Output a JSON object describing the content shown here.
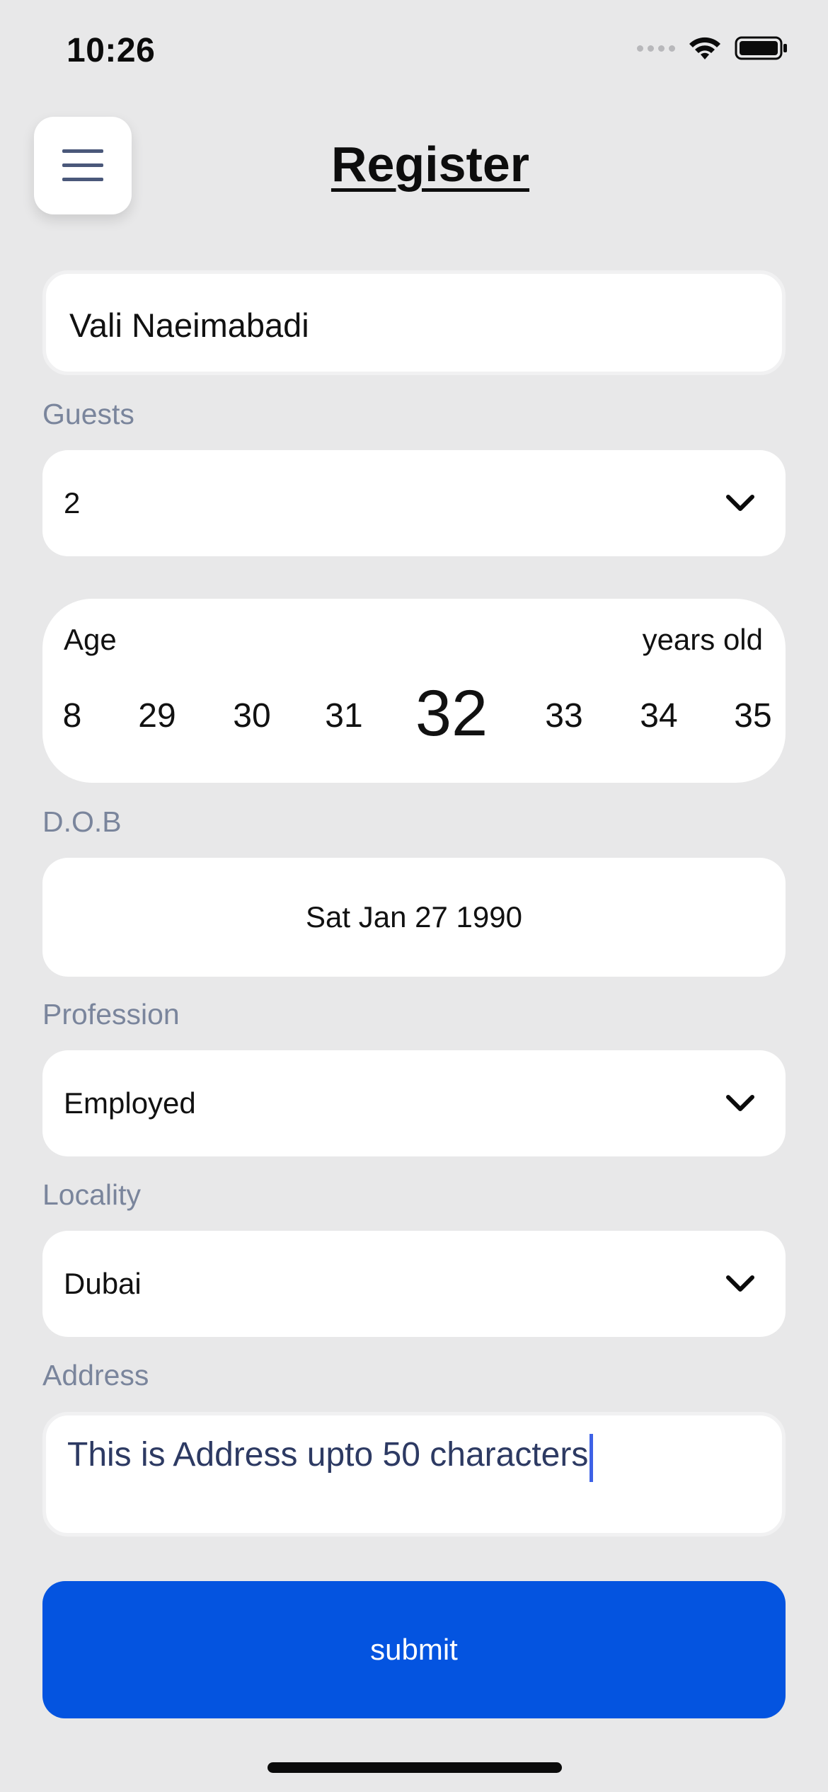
{
  "status_bar": {
    "time": "10:26"
  },
  "header": {
    "title": "Register",
    "menu_icon": "hamburger-menu-icon"
  },
  "form": {
    "name": {
      "value": "Vali Naeimabadi"
    },
    "guests": {
      "label": "Guests",
      "value": "2"
    },
    "age": {
      "label": "Age",
      "unit": "years old",
      "options": [
        "8",
        "29",
        "30",
        "31",
        "32",
        "33",
        "34",
        "35"
      ],
      "selected": "32"
    },
    "dob": {
      "label": "D.O.B",
      "value": "Sat Jan 27 1990"
    },
    "profession": {
      "label": "Profession",
      "value": "Employed"
    },
    "locality": {
      "label": "Locality",
      "value": "Dubai"
    },
    "address": {
      "label": "Address",
      "value": "This is Address upto 50 characters"
    },
    "submit_label": "submit"
  },
  "colors": {
    "background": "#e8e8e9",
    "label": "#7a859c",
    "primary_button": "#0454e0",
    "address_text": "#2d3a63",
    "caret": "#3e62e6"
  }
}
